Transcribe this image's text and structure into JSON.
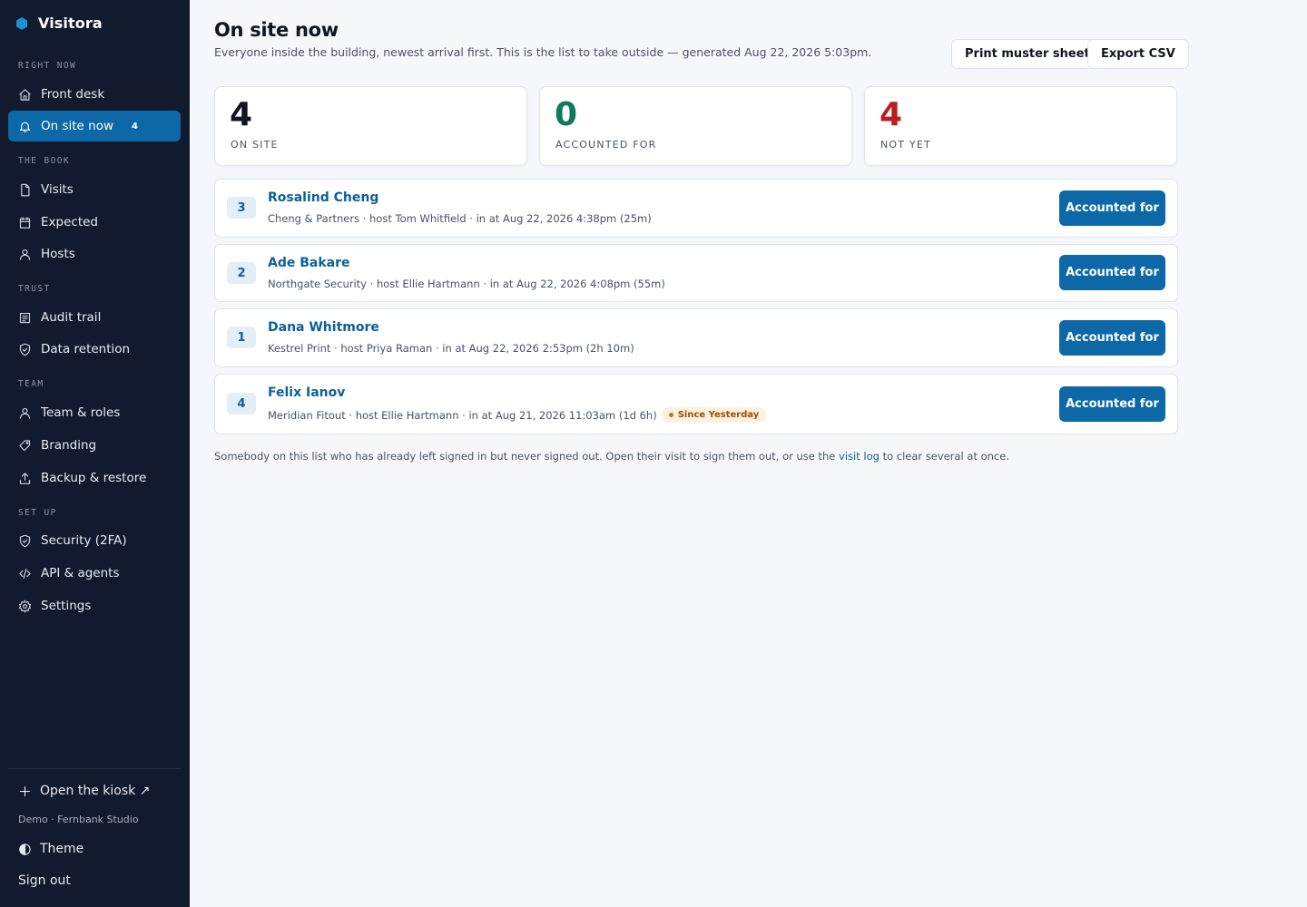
{
  "brand": {
    "name": "Visitora",
    "color": "#1e8fd6"
  },
  "sidebar": {
    "sections": [
      {
        "label": "RIGHT NOW"
      },
      {
        "label": "THE BOOK"
      },
      {
        "label": "TRUST"
      },
      {
        "label": "TEAM"
      },
      {
        "label": "SET UP"
      }
    ],
    "items": [
      {
        "label": "Front desk",
        "icon": "home-icon"
      },
      {
        "label": "On site now",
        "icon": "bell-icon",
        "badge": "4",
        "active": true
      },
      {
        "label": "Visits",
        "icon": "file-icon"
      },
      {
        "label": "Expected",
        "icon": "calendar-icon"
      },
      {
        "label": "Hosts",
        "icon": "user-icon"
      },
      {
        "label": "Audit trail",
        "icon": "list-icon"
      },
      {
        "label": "Data retention",
        "icon": "shield-check-icon"
      },
      {
        "label": "Team & roles",
        "icon": "user-icon"
      },
      {
        "label": "Branding",
        "icon": "tag-icon"
      },
      {
        "label": "Backup & restore",
        "icon": "upload-icon"
      },
      {
        "label": "Security (2FA)",
        "icon": "shield-check-icon"
      },
      {
        "label": "API & agents",
        "icon": "code-icon"
      },
      {
        "label": "Settings",
        "icon": "gear-icon"
      }
    ],
    "footer": {
      "kiosk_label": "Open the kiosk ↗",
      "demo_label": "Demo · Fernbank Studio",
      "theme_label": "Theme",
      "signout_label": "Sign out"
    }
  },
  "header": {
    "title": "On site now",
    "subtitle": "Everyone inside the building, newest arrival first. This is the list to take outside — generated Aug 22, 2026 5:03pm.",
    "print_label": "Print muster sheet",
    "export_label": "Export CSV"
  },
  "stats": [
    {
      "value": "4",
      "label": "ON SITE",
      "color": "#11151f"
    },
    {
      "value": "0",
      "label": "ACCOUNTED FOR",
      "color": "#0f7a5c"
    },
    {
      "value": "4",
      "label": "NOT YET",
      "color": "#b81f1f"
    }
  ],
  "visitors": [
    {
      "number": "3",
      "name": "Rosalind Cheng",
      "meta": "Cheng & Partners · host Tom Whitfield · in at Aug 22, 2026 4:38pm (25m)",
      "badge": "",
      "action": "Accounted for"
    },
    {
      "number": "2",
      "name": "Ade Bakare",
      "meta": "Northgate Security · host Ellie Hartmann · in at Aug 22, 2026 4:08pm (55m)",
      "badge": "",
      "action": "Accounted for"
    },
    {
      "number": "1",
      "name": "Dana Whitmore",
      "meta": "Kestrel Print · host Priya Raman · in at Aug 22, 2026 2:53pm (2h 10m)",
      "badge": "",
      "action": "Accounted for"
    },
    {
      "number": "4",
      "name": "Felix Ianov",
      "meta": "Meridian Fitout · host Ellie Hartmann · in at Aug 21, 2026 11:03am (1d 6h)",
      "badge": "Since Yesterday",
      "action": "Accounted for"
    }
  ],
  "footnote": {
    "before": "Somebody on this list who has already left signed in but never signed out. Open their visit to sign them out, or use the ",
    "link": "visit log",
    "after": " to clear several at once."
  },
  "colors": {
    "accent": "#0d68a8",
    "sidebar_bg": "#121a2e",
    "page_bg": "#f5f7fb"
  }
}
